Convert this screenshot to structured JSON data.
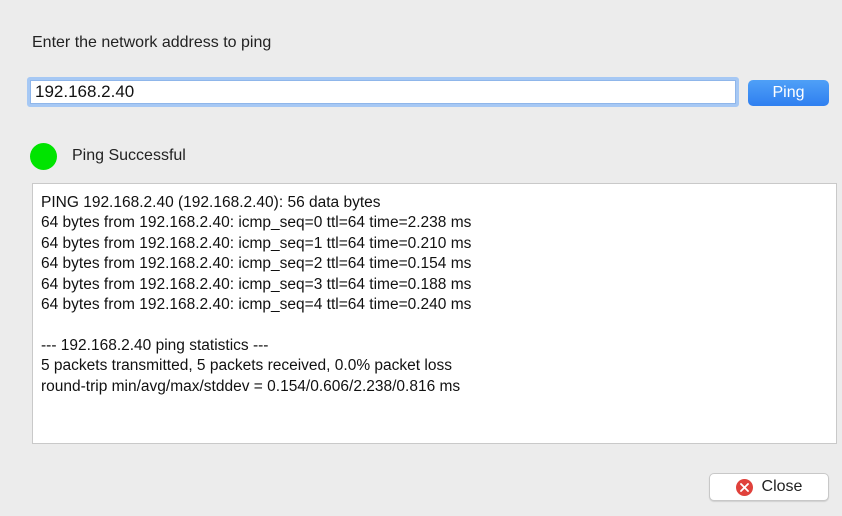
{
  "prompt": {
    "label": "Enter the network address to ping"
  },
  "address_input": {
    "value": "192.168.2.40",
    "placeholder": ""
  },
  "ping_button": {
    "label": "Ping"
  },
  "status": {
    "text": "Ping Successful",
    "color": "#00e400",
    "icon": "status-indicator-icon"
  },
  "output": {
    "lines": [
      "PING 192.168.2.40 (192.168.2.40): 56 data bytes",
      "64 bytes from 192.168.2.40: icmp_seq=0 ttl=64 time=2.238 ms",
      "64 bytes from 192.168.2.40: icmp_seq=1 ttl=64 time=0.210 ms",
      "64 bytes from 192.168.2.40: icmp_seq=2 ttl=64 time=0.154 ms",
      "64 bytes from 192.168.2.40: icmp_seq=3 ttl=64 time=0.188 ms",
      "64 bytes from 192.168.2.40: icmp_seq=4 ttl=64 time=0.240 ms",
      "",
      "--- 192.168.2.40 ping statistics ---",
      "5 packets transmitted, 5 packets received, 0.0% packet loss",
      "round-trip min/avg/max/stddev = 0.154/0.606/2.238/0.816 ms"
    ]
  },
  "close_button": {
    "label": "Close",
    "icon": "close-icon",
    "icon_color": "#e0413b"
  },
  "colors": {
    "accent": "#2f7ff0",
    "focus_ring": "#a6c8f4",
    "background": "#ececec"
  }
}
